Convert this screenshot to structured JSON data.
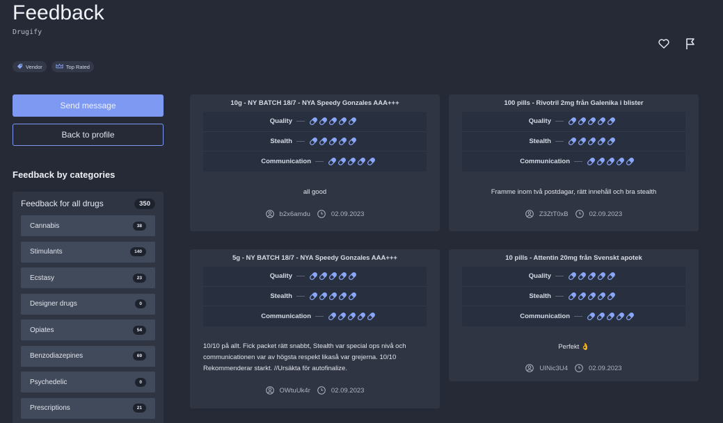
{
  "header": {
    "title": "Feedback",
    "vendor": "Drugify",
    "badges": [
      {
        "label": "Vendor",
        "icon": "tag-icon"
      },
      {
        "label": "Top Rated",
        "icon": "crown-icon"
      }
    ],
    "actions": [
      {
        "name": "favorite-heart-icon"
      },
      {
        "name": "report-flag-icon"
      }
    ]
  },
  "sidebar": {
    "send_message": "Send message",
    "back_to_profile": "Back to profile",
    "categories_heading": "Feedback by categories",
    "all_label": "Feedback for all drugs",
    "all_count": "350",
    "categories": [
      {
        "label": "Cannabis",
        "count": "38"
      },
      {
        "label": "Stimulants",
        "count": "140"
      },
      {
        "label": "Ecstasy",
        "count": "23"
      },
      {
        "label": "Designer drugs",
        "count": "0"
      },
      {
        "label": "Opiates",
        "count": "54"
      },
      {
        "label": "Benzodiazepines",
        "count": "69"
      },
      {
        "label": "Psychedelic",
        "count": "0"
      },
      {
        "label": "Prescriptions",
        "count": "21"
      }
    ]
  },
  "ratings_labels": {
    "quality": "Quality",
    "stealth": "Stealth",
    "communication": "Communication"
  },
  "colors": {
    "pill": "#8aa6f8",
    "accent": "#7e99f2"
  },
  "feedback": [
    {
      "title": "10g - NY BATCH 18/7 - NYA Speedy Gonzales AAA+++",
      "quality": 5,
      "stealth": 5,
      "communication": 5,
      "comment": "all good",
      "user": "b2x6amdu",
      "date": "02.09.2023"
    },
    {
      "title": "100 pills - Rivotril 2mg från Galenika i blister",
      "quality": 5,
      "stealth": 5,
      "communication": 5,
      "comment": "Framme inom två postdagar, rätt innehåll och bra stealth",
      "user": "Z3ZtT0xB",
      "date": "02.09.2023"
    },
    {
      "title": "5g - NY BATCH 18/7 - NYA Speedy Gonzales AAA+++",
      "quality": 5,
      "stealth": 5,
      "communication": 5,
      "comment": "10/10 på allt. Fick packet rätt snabbt, Stealth var special ops nivå och communicationen var av högsta respekt likaså var grejerna. 10/10 Rekommenderar starkt. //Ursäkta för autofinalize.",
      "user": "OWtuUk4r",
      "date": "02.09.2023"
    },
    {
      "title": "10 pills - Attentin 20mg från Svenskt apotek",
      "quality": 5,
      "stealth": 5,
      "communication": 5,
      "comment": "Perfekt 👌",
      "user": "UINic3U4",
      "date": "02.09.2023"
    }
  ]
}
